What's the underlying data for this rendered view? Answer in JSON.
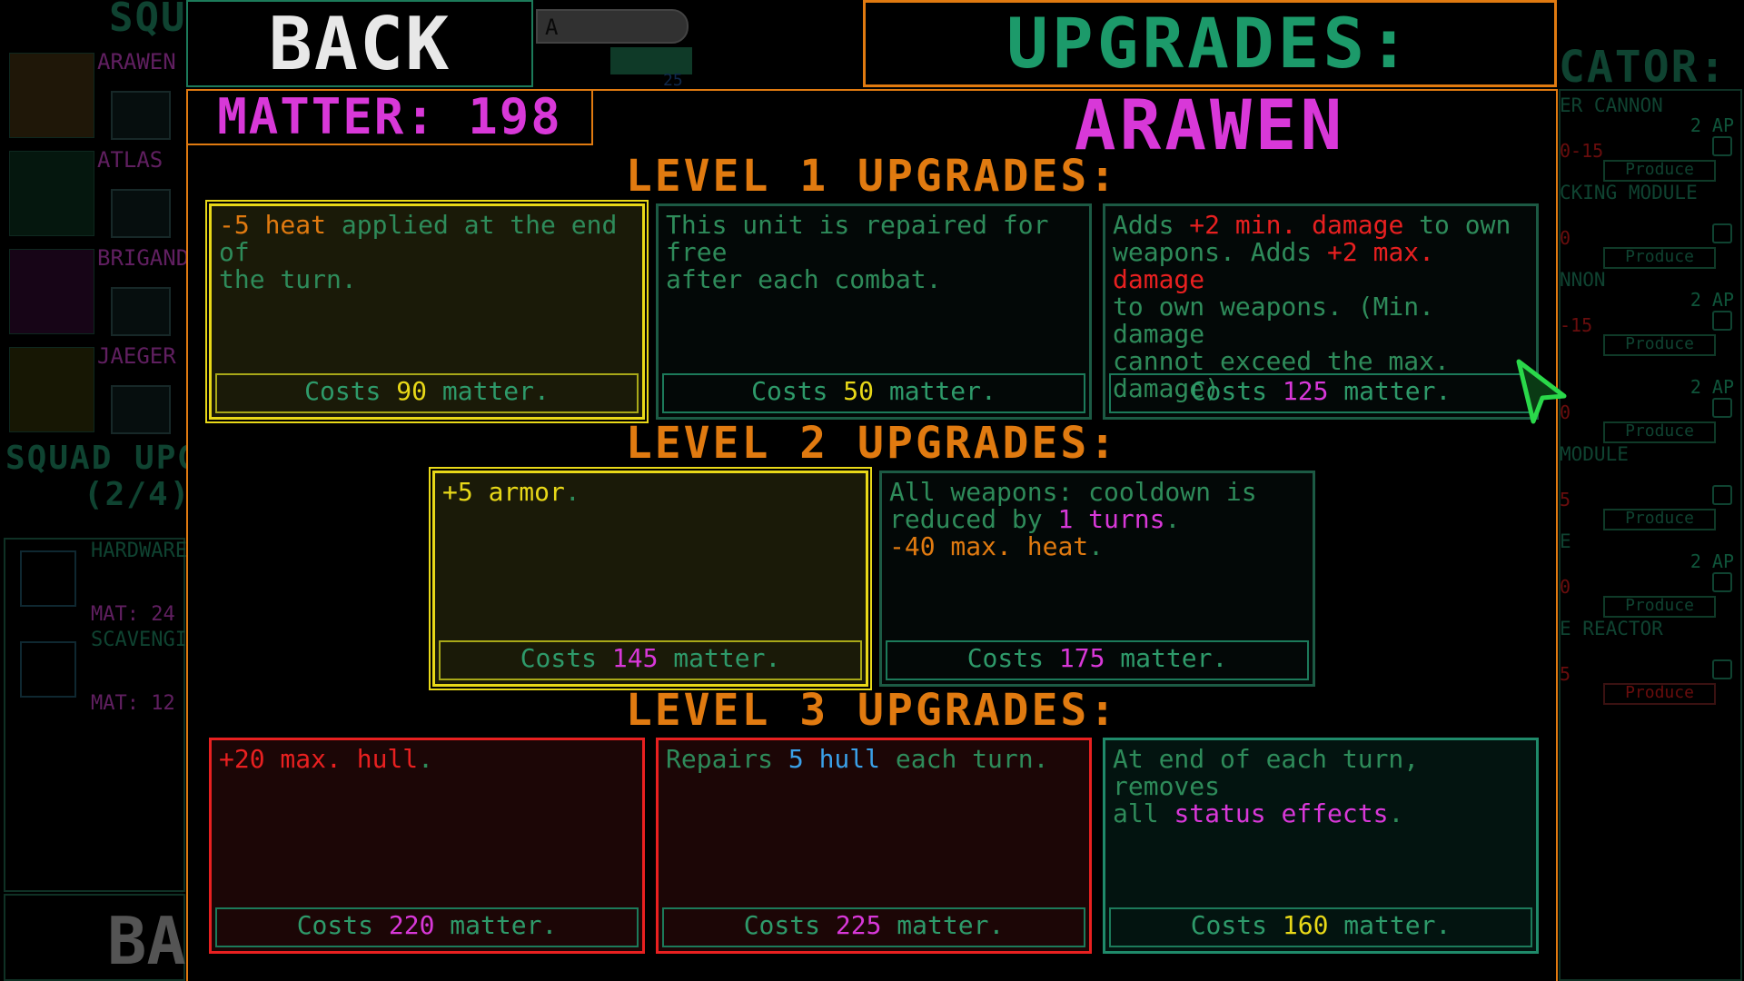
{
  "background": {
    "left_title": "SQUAD",
    "units": [
      {
        "name": "ARAWEN"
      },
      {
        "name": "ATLAS"
      },
      {
        "name": "BRIGANDINE"
      },
      {
        "name": "JAEGER"
      }
    ],
    "squad_upgrades_label": "SQUAD UPGR",
    "squad_upgrades_count": "(2/4)",
    "squad_items": [
      {
        "name": "HARDWARE",
        "mat": "MAT: 24"
      },
      {
        "name": "SCAVENGING",
        "mat": "MAT: 12"
      }
    ],
    "bottom_back": "BACK",
    "meter_label": "A",
    "meter_value": "25",
    "right_title": "CATOR:",
    "right_items": [
      {
        "name": "ER CANNON",
        "ap": "2 AP",
        "num": "0-15",
        "produce": "Produce"
      },
      {
        "name": "CKING MODULE",
        "ap": "",
        "num": "0",
        "produce": "Produce"
      },
      {
        "name": "NNON",
        "ap": "2 AP",
        "num": "-15",
        "produce": "Produce"
      },
      {
        "name": "",
        "ap": "2 AP",
        "num": "0",
        "produce": "Produce"
      },
      {
        "name": "MODULE",
        "ap": "",
        "num": "5",
        "produce": "Produce"
      },
      {
        "name": "E",
        "ap": "2 AP",
        "num": "0",
        "produce": "Produce"
      },
      {
        "name": "E REACTOR",
        "ap": "",
        "num": "5",
        "produce": "Produce"
      }
    ]
  },
  "header": {
    "back_label": "BACK",
    "title_prefix": "UPGRADES: ",
    "title_unit": "ARAWEN",
    "matter": "MATTER: 198"
  },
  "levels": [
    {
      "heading": "LEVEL 1 UPGRADES:"
    },
    {
      "heading": "LEVEL 2 UPGRADES:"
    },
    {
      "heading": "LEVEL 3 UPGRADES:"
    }
  ],
  "cards": {
    "l1a": {
      "cost_prefix": "Costs ",
      "cost": "90",
      "cost_suffix": " matter."
    },
    "l1b": {
      "cost_prefix": "Costs ",
      "cost": "50",
      "cost_suffix": " matter."
    },
    "l1c": {
      "cost_prefix": "Costs ",
      "cost": "125",
      "cost_suffix": " matter."
    },
    "l2a": {
      "cost_prefix": "Costs ",
      "cost": "145",
      "cost_suffix": " matter."
    },
    "l2b": {
      "cost_prefix": "Costs ",
      "cost": "175",
      "cost_suffix": " matter."
    },
    "l3a": {
      "cost_prefix": "Costs ",
      "cost": "220",
      "cost_suffix": " matter."
    },
    "l3b": {
      "cost_prefix": "Costs ",
      "cost": "225",
      "cost_suffix": " matter."
    },
    "l3c": {
      "cost_prefix": "Costs ",
      "cost": "160",
      "cost_suffix": " matter."
    }
  },
  "card_text": {
    "l1a": [
      "-5",
      " heat",
      " applied at the end of\nthe turn."
    ],
    "l1b": [
      "This unit is repaired for free\nafter each combat."
    ],
    "l1c": [
      "Adds ",
      "+2",
      " min. damage",
      " to own\nweapons. Adds ",
      "+2",
      " max. damage",
      "\nto own weapons. (Min. damage\ncannot exceed the max. damage)"
    ],
    "l2a": [
      "+5",
      " armor",
      "."
    ],
    "l2b": [
      "All weapons: cooldown is\nreduced by ",
      "1",
      " turns",
      ".\n",
      "-40",
      " max. heat",
      "."
    ],
    "l3a": [
      "+20",
      " max. hull",
      "."
    ],
    "l3b": [
      "Repairs ",
      "5",
      " hull",
      " each turn."
    ],
    "l3c": [
      "At end of each turn, removes\nall ",
      "status effects",
      "."
    ]
  },
  "colors": {
    "orange": "#e07a10",
    "magenta": "#d838d8",
    "red": "#e82020",
    "yellow": "#e8d818",
    "green": "#2e8b5a",
    "blue": "#3aa0e8",
    "cursor": "#2ad84a"
  }
}
